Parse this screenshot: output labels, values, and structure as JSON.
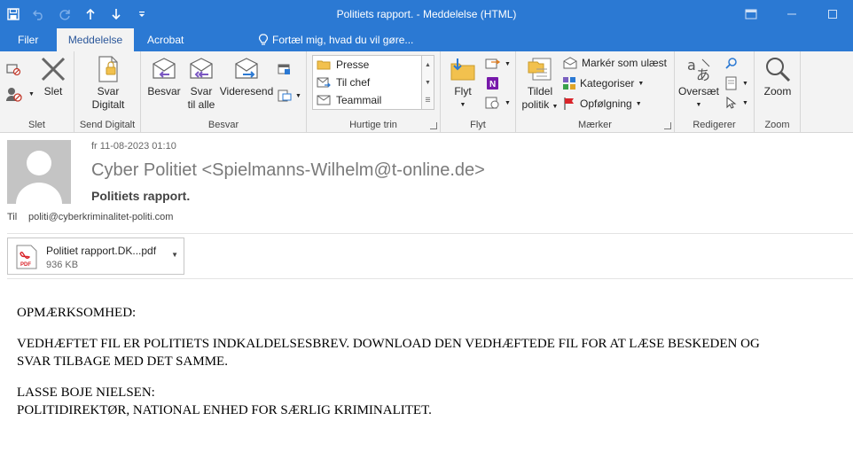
{
  "window": {
    "title": "Politiets rapport. - Meddelelse (HTML)"
  },
  "tabs": [
    {
      "label": "Filer"
    },
    {
      "label": "Meddelelse"
    },
    {
      "label": "Acrobat"
    }
  ],
  "tellme": {
    "label": "Fortæl mig, hvad du vil gøre..."
  },
  "ribbon": {
    "slet": {
      "delete_label": "Slet",
      "group_label": "Slet"
    },
    "send_digitalt": {
      "btn_line1": "Svar",
      "btn_line2": "Digitalt",
      "group_label": "Send Digitalt"
    },
    "besvar": {
      "reply": "Besvar",
      "reply_all_1": "Svar",
      "reply_all_2": "til alle",
      "forward": "Videresend",
      "group_label": "Besvar"
    },
    "quick_steps": {
      "items": [
        "Presse",
        "Til chef",
        "Teammail"
      ],
      "group_label": "Hurtige trin"
    },
    "flyt": {
      "move_label": "Flyt",
      "group_label": "Flyt"
    },
    "maerker": {
      "assign_1": "Tildel",
      "assign_2": "politik",
      "mark_unread": "Markér som ulæst",
      "categorize": "Kategoriser",
      "followup": "Opfølgning",
      "group_label": "Mærker"
    },
    "redigerer": {
      "translate": "Oversæt",
      "group_label": "Redigerer"
    },
    "zoom": {
      "zoom_label": "Zoom",
      "group_label": "Zoom"
    }
  },
  "message": {
    "date": "fr 11-08-2023 01:10",
    "sender": "Cyber Politiet <Spielmanns-Wilhelm@t-online.de>",
    "subject": "Politiets rapport.",
    "to_label": "Til",
    "to_address": "politi@cyberkriminalitet-politi.com",
    "attachment": {
      "name": "Politiet rapport.DK...pdf",
      "size": "936 KB",
      "type_label": "PDF"
    }
  },
  "body": {
    "line1": "OPMÆRKSOMHED:",
    "line2": "VEDHÆFTET FIL ER POLITIETS INDKALDELSESBREV. DOWNLOAD DEN VEDHÆFTEDE FIL FOR AT LÆSE BESKEDEN OG",
    "line3": "SVAR TILBAGE MED DET SAMME.",
    "line4": "LASSE BOJE NIELSEN:",
    "line5": "POLITIDIREKTØR, NATIONAL ENHED FOR SÆRLIG KRIMINALITET."
  },
  "colors": {
    "accent": "#2b79d3",
    "ribbon_bg": "#f3f3f3",
    "pdf_red": "#d9242a"
  }
}
